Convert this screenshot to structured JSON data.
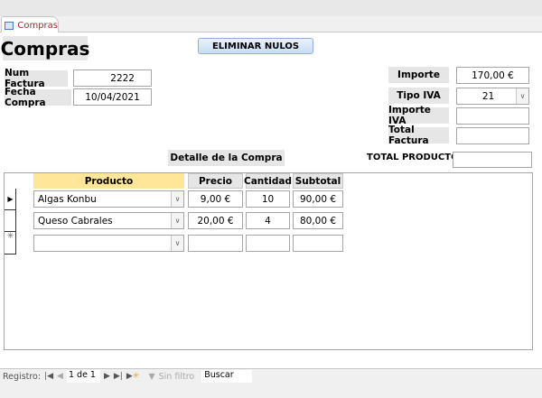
{
  "tab": {
    "label": "Compras"
  },
  "form": {
    "title": "Compras",
    "eliminar_button": "ELIMINAR NULOS",
    "num_factura": {
      "label": "Num Factura",
      "value": "2222"
    },
    "fecha_compra": {
      "label": "Fecha Compra",
      "value": "10/04/2021"
    },
    "importe": {
      "label": "Importe",
      "value": "170,00 €"
    },
    "tipo_iva": {
      "label": "Tipo IVA",
      "value": "21"
    },
    "importe_iva": {
      "label": "Importe IVA",
      "value": ""
    },
    "total_factura": {
      "label": "Total Factura",
      "value": ""
    },
    "detalle_label": "Detalle de la Compra",
    "total_productos": {
      "label": "TOTAL PRODUCTOS",
      "value": ""
    }
  },
  "subform": {
    "columns": [
      "Producto",
      "Precio",
      "Cantidad",
      "Subtotal"
    ],
    "rows": [
      {
        "producto": "Algas Konbu",
        "precio": "9,00 €",
        "cantidad": "10",
        "subtotal": "90,00 €"
      },
      {
        "producto": "Queso Cabrales",
        "precio": "20,00 €",
        "cantidad": "4",
        "subtotal": "80,00 €"
      }
    ]
  },
  "navbar": {
    "label": "Registro:",
    "position": "1 de 1",
    "filter": "Sin filtro",
    "search": "Buscar"
  },
  "colors": {
    "header_highlight": "#ffe699",
    "title_color": "#9c2a2a"
  }
}
